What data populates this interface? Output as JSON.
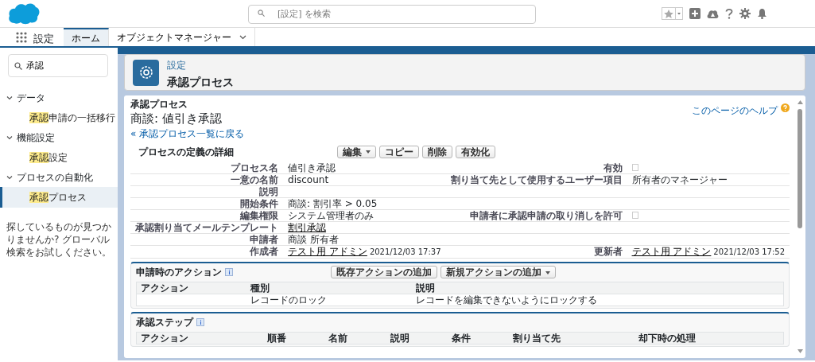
{
  "header": {
    "search": {
      "placeholder": "[設定] を検索"
    }
  },
  "nav": {
    "app_title": "設定",
    "tabs": [
      {
        "label": "ホーム",
        "selected": true,
        "dropdown": false
      },
      {
        "label": "オブジェクトマネージャー",
        "selected": false,
        "dropdown": true
      }
    ]
  },
  "sidebar": {
    "search": {
      "value": "承認"
    },
    "tree": [
      {
        "label": "データ",
        "expanded": true,
        "children": [
          {
            "match": "承認",
            "rest": "申請の一括移行",
            "selected": false
          }
        ]
      },
      {
        "label": "機能設定",
        "expanded": true,
        "children": [
          {
            "match": "承認",
            "rest": "設定",
            "selected": false
          }
        ]
      },
      {
        "label": "プロセスの自動化",
        "expanded": true,
        "children": [
          {
            "match": "承認",
            "rest": "プロセス",
            "selected": true
          }
        ]
      }
    ],
    "not_found": "探しているものが見つかりませんか? グローバル検索をお試しください。"
  },
  "page_header": {
    "breadcrumb": "設定",
    "title": "承認プロセス"
  },
  "content": {
    "type_label": "承認プロセス",
    "title": "商談: 値引き承認",
    "back_link": "« 承認プロセス一覧に戻る",
    "help_link": "このページのヘルプ",
    "detail": {
      "title": "プロセスの定義の詳細",
      "buttons": [
        {
          "label": "編集",
          "dropdown": true
        },
        {
          "label": "コピー",
          "dropdown": false
        },
        {
          "label": "削除",
          "dropdown": false
        },
        {
          "label": "有効化",
          "dropdown": false
        }
      ],
      "rows": [
        {
          "left": {
            "label": "プロセス名",
            "kind": "text",
            "text": "値引き承認"
          },
          "right": {
            "label": "有効",
            "kind": "checkbox",
            "checked": false
          }
        },
        {
          "left": {
            "label": "一意の名前",
            "kind": "text",
            "text": "discount"
          },
          "right": {
            "label": "割り当て先として使用するユーザー項目",
            "kind": "text",
            "text": "所有者のマネージャー"
          }
        },
        {
          "left": {
            "label": "説明",
            "kind": "empty"
          }
        },
        {
          "left": {
            "label": "開始条件",
            "kind": "text",
            "text": "商談: 割引率 > 0.05"
          }
        },
        {
          "left": {
            "label": "編集権限",
            "kind": "text",
            "text": "システム管理者のみ"
          },
          "right": {
            "label": "申請者に承認申請の取り消しを許可",
            "kind": "checkbox",
            "checked": false
          }
        },
        {
          "left": {
            "label": "承認割り当てメールテンプレート",
            "kind": "link",
            "text": "割引承認"
          }
        },
        {
          "left": {
            "label": "申請者",
            "kind": "text",
            "text": "商談 所有者"
          }
        },
        {
          "left": {
            "label": "作成者",
            "kind": "user",
            "text": "テスト用 アドミン",
            "date": "2021/12/03 17:37"
          },
          "right": {
            "label": "更新者",
            "kind": "user",
            "text": "テスト用 アドミン",
            "date": "2021/12/03 17:52"
          }
        }
      ]
    },
    "actions": {
      "title": "申請時のアクション",
      "buttons": [
        {
          "label": "既存アクションの追加",
          "dropdown": false
        },
        {
          "label": "新規アクションの追加",
          "dropdown": true
        }
      ],
      "columns": [
        "アクション",
        "種別",
        "説明"
      ],
      "rows": [
        [
          "",
          "レコードのロック",
          "レコードを編集できないようにロックする"
        ]
      ]
    },
    "steps": {
      "title": "承認ステップ",
      "columns": [
        "アクション",
        "順番",
        "名前",
        "説明",
        "条件",
        "割り当て先",
        "却下時の処理"
      ]
    }
  }
}
